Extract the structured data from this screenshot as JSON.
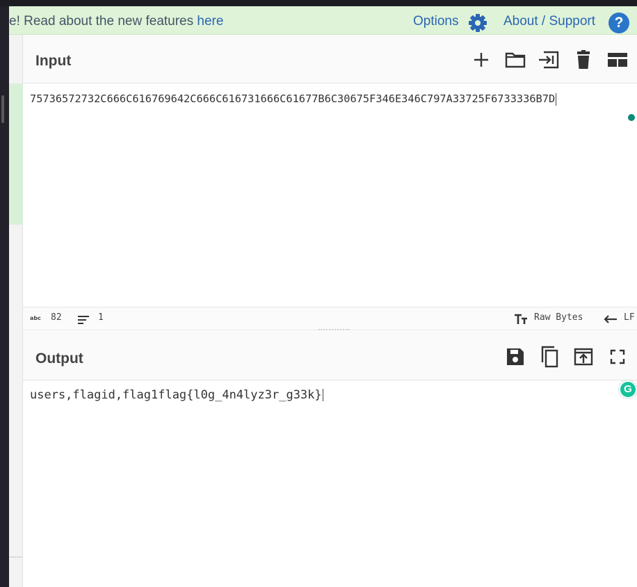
{
  "banner": {
    "message": "e! Read about the new features ",
    "link_text": "here",
    "options_label": "Options",
    "about_label": "About / Support",
    "help_glyph": "?"
  },
  "input": {
    "title": "Input",
    "value": "75736572732C666C616769642C666C616731666C61677B6C30675F346E346C797A33725F6733336B7D",
    "toolbar_icons": [
      "plus-icon",
      "folder-icon",
      "import-icon",
      "trash-icon",
      "layout-icon"
    ]
  },
  "status": {
    "length_label": "abc",
    "length": "82",
    "lines": "1",
    "encoding_label": "Raw Bytes",
    "eol_label": "LF"
  },
  "output": {
    "title": "Output",
    "value": "users,flagid,flag1flag{l0g_4n4lyz3r_g33k}",
    "toolbar_icons": [
      "save-icon",
      "copy-icon",
      "replace-input-icon",
      "maximise-icon"
    ]
  },
  "grammarly_glyph": "G",
  "colors": {
    "banner_bg": "#dff3d8",
    "link": "#2a66b3",
    "teal_dot": "#0f8a7a",
    "grammarly": "#15c39a"
  }
}
